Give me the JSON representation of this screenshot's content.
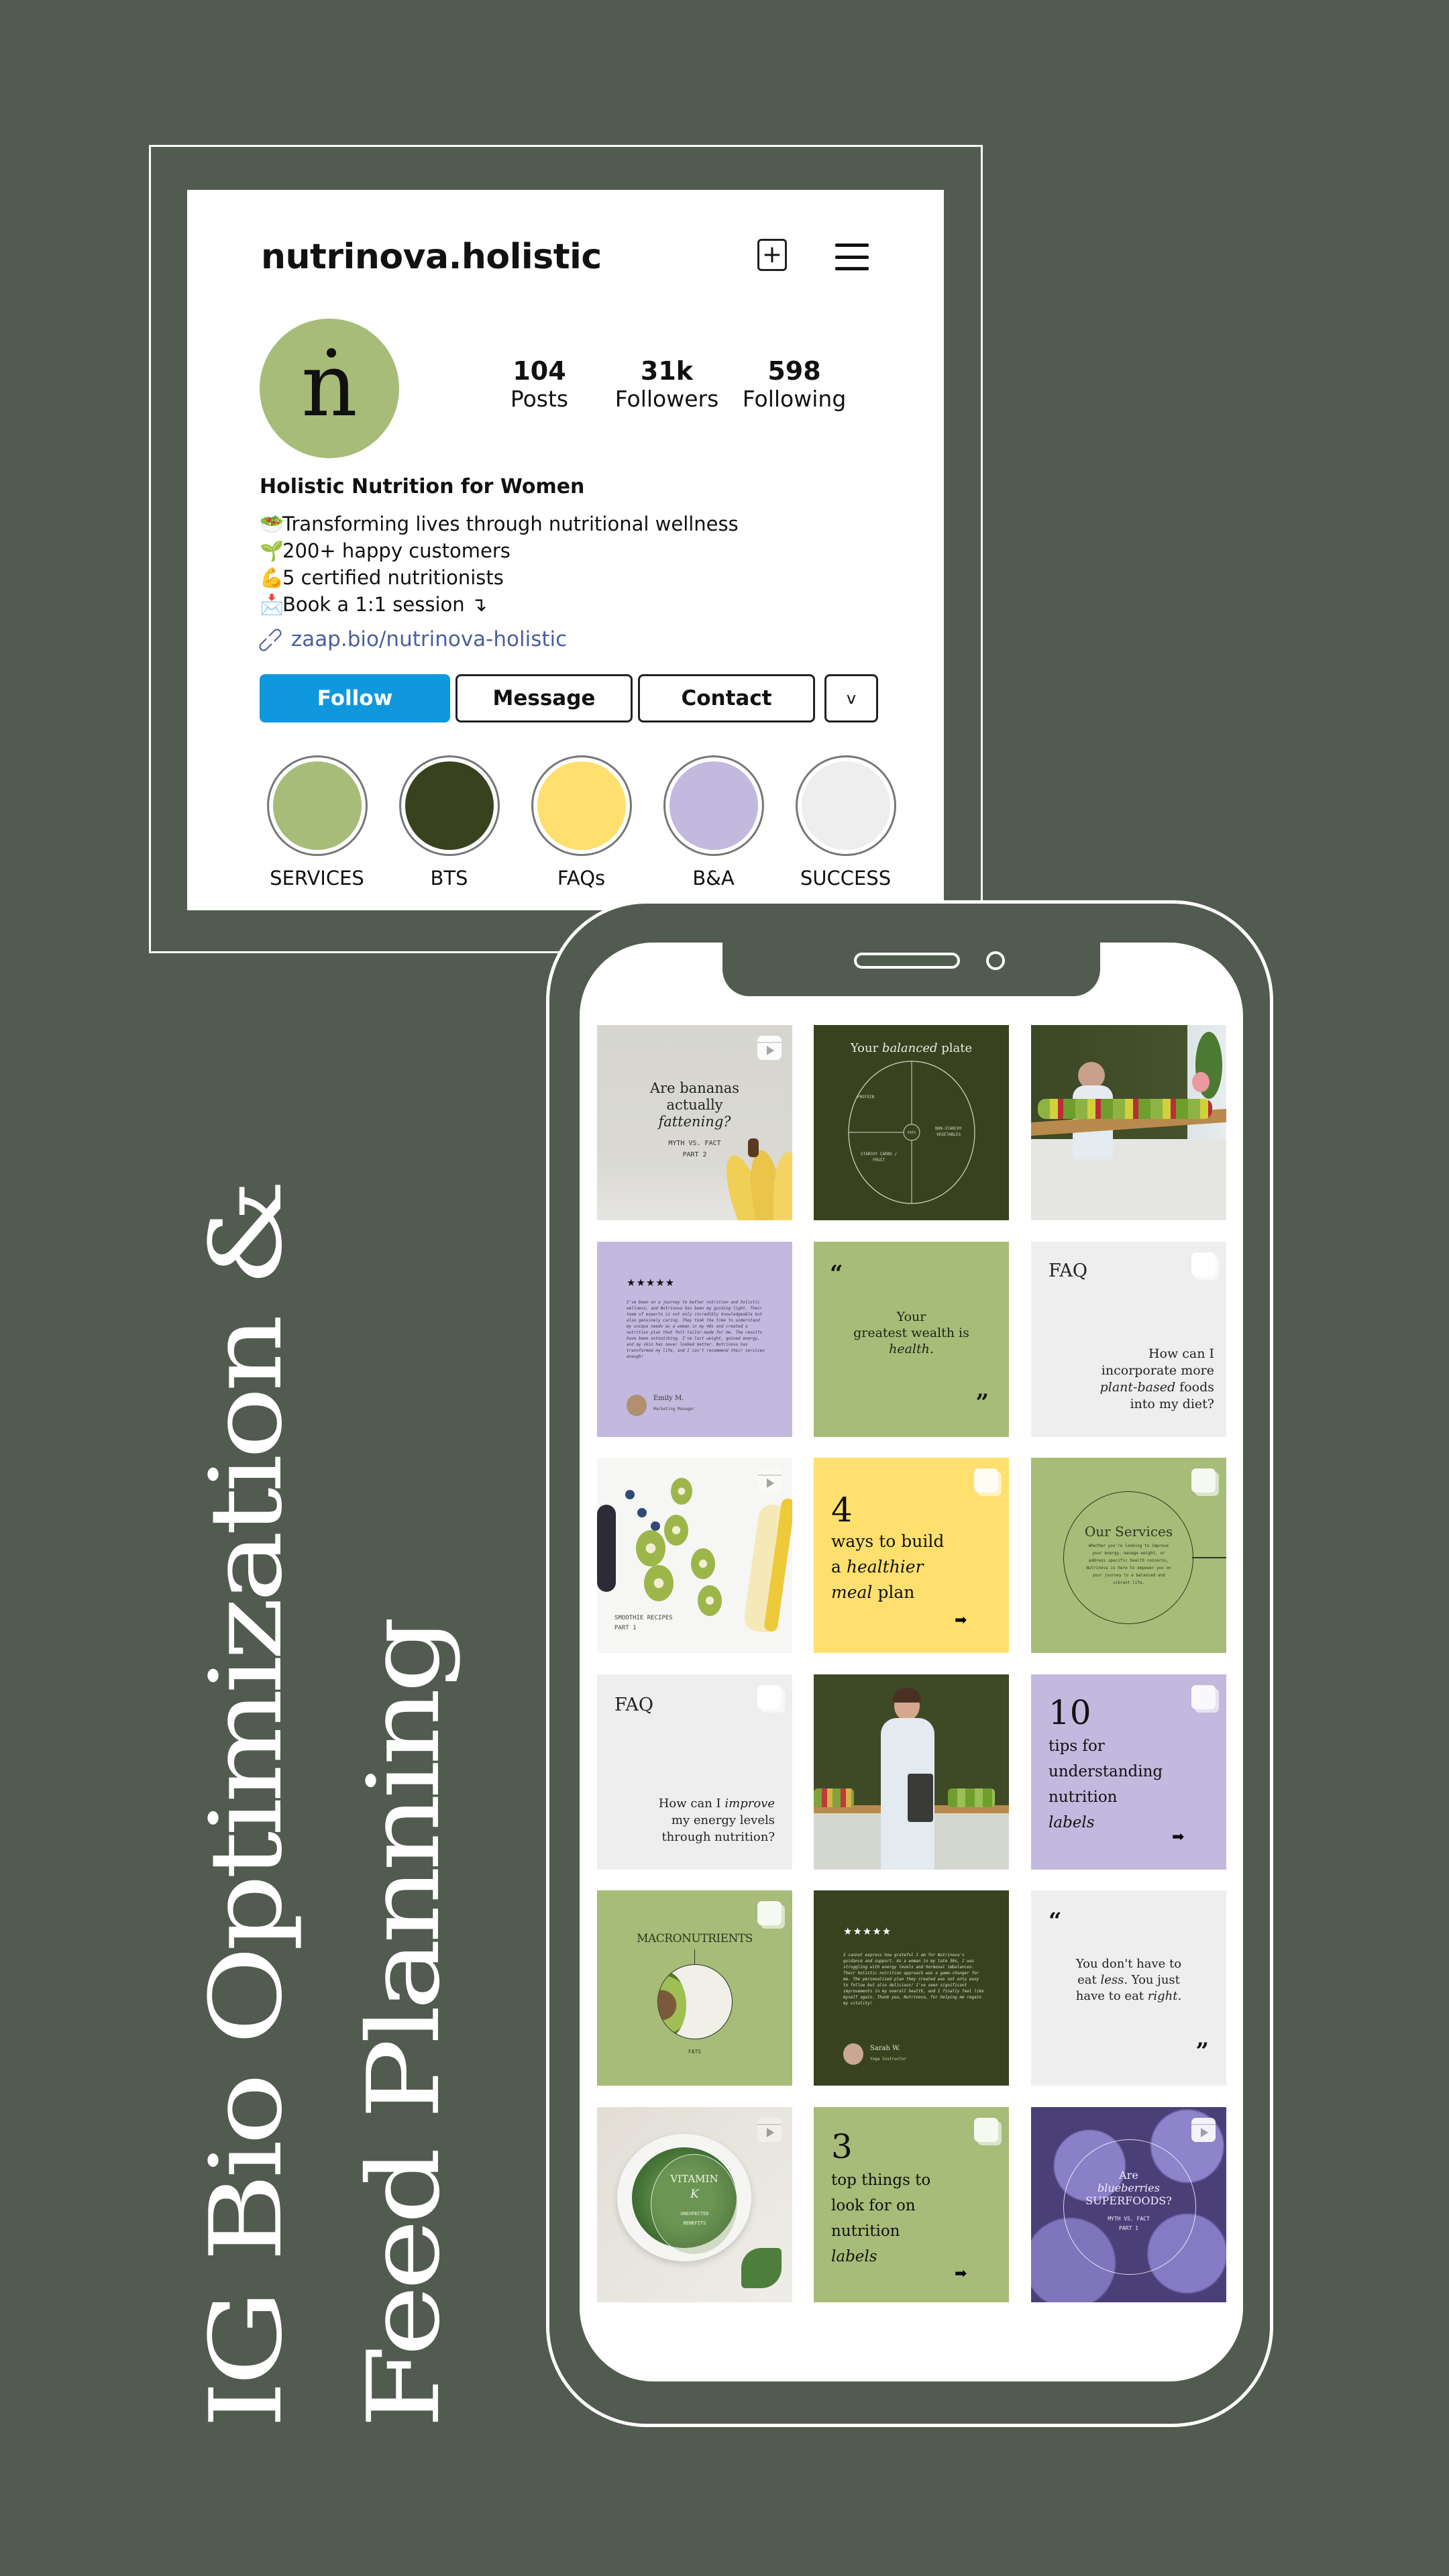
{
  "colors": {
    "background": "#515B4F",
    "follow_blue": "#1098DE",
    "sage_green": "#A6BC78",
    "dark_olive": "#38421F",
    "yellow": "#FFE06F",
    "lavender": "#C3B9DE",
    "light_gray": "#EEEEEE",
    "link_blue": "#4B5F9A"
  },
  "title": {
    "line1": "IG Bio Optimization &",
    "line2": "Feed Planning"
  },
  "profile": {
    "username": "nutrinova.holistic",
    "add_icon": "plus-square-icon",
    "menu_icon": "hamburger-menu-icon",
    "avatar_letter": "n",
    "stats": [
      {
        "value": "104",
        "label": "Posts"
      },
      {
        "value": "31k",
        "label": "Followers"
      },
      {
        "value": "598",
        "label": "Following"
      }
    ],
    "bio_name": "Holistic Nutrition for Women",
    "bio_lines": [
      {
        "emoji": "🥗",
        "text": "Transforming lives through nutritional wellness"
      },
      {
        "emoji": "🌱",
        "text": "200+ happy customers"
      },
      {
        "emoji": "💪",
        "text": "5 certified nutritionists"
      },
      {
        "emoji": "📩",
        "text": "Book a 1:1 session ↴"
      }
    ],
    "link_icon": "link-icon",
    "link": "zaap.bio/nutrinova-holistic",
    "buttons": {
      "follow": "Follow",
      "message": "Message",
      "contact": "Contact",
      "more": "v"
    },
    "highlights": [
      {
        "label": "SERVICES",
        "color": "#A6BC78"
      },
      {
        "label": "BTS",
        "color": "#38421F"
      },
      {
        "label": "FAQs",
        "color": "#FFE06F"
      },
      {
        "label": "B&A",
        "color": "#C3B9DE"
      },
      {
        "label": "SUCCESS",
        "color": "#EEEEEE"
      }
    ]
  },
  "feed": {
    "posts": [
      {
        "type": "reel",
        "bg": "#D9D8D3",
        "lines": [
          "Are bananas",
          "actually",
          "fattening?"
        ],
        "sub": [
          "MYTH VS. FACT",
          "PART 2"
        ]
      },
      {
        "type": "image",
        "bg": "#38421F",
        "title_pre": "Your",
        "title_em": "balanced",
        "title_post": "plate",
        "plate_labels": [
          "PROTEIN",
          "FATS",
          "NON-STARCHY VEGETABLES",
          "STARCHY CARBS / FRUIT"
        ]
      },
      {
        "type": "photo",
        "bg": "#3E4A26",
        "alt": "Nutritionist at table with vegetables"
      },
      {
        "type": "image",
        "bg": "#C3B9DE",
        "stars": "★★★★★",
        "review": "I've been on a journey to better nutrition and holistic wellness, and Nutrinova has been my guiding light. Their team of experts is not only incredibly knowledgeable but also genuinely caring. They took the time to understand my unique needs as a woman in my 40s and created a nutrition plan that felt tailor-made for me. The results have been astonishing. I've lost weight, gained energy, and my skin has never looked better. Nutrinova has transformed my life, and I can't recommend their services enough!",
        "name": "Emily M.",
        "role": "Marketing Manager"
      },
      {
        "type": "image",
        "bg": "#A6BC78",
        "quote_open": "“",
        "quote_close": "”",
        "lines": [
          "Your",
          "greatest wealth is"
        ],
        "em": "health."
      },
      {
        "type": "carousel",
        "bg": "#EEEEEE",
        "label": "FAQ",
        "lines": [
          "How can I",
          "incorporate more"
        ],
        "em": "plant-based",
        "after": "foods",
        "last": "into my diet?"
      },
      {
        "type": "reel",
        "bg": "#F6F6F4",
        "caption": [
          "SMOOTHIE RECIPES",
          "PART 1"
        ]
      },
      {
        "type": "carousel",
        "bg": "#FFE06F",
        "number": "4",
        "lines": [
          "ways to build"
        ],
        "em1": "healthier",
        "pre1": "a",
        "em2": "meal",
        "post2": "plan"
      },
      {
        "type": "carousel",
        "bg": "#A6BC78",
        "heading": "Our Services",
        "body": "Whether you're looking to improve your energy, manage weight, or address specific health concerns, Nutrinova is here to empower you on your journey to a balanced and vibrant life."
      },
      {
        "type": "carousel",
        "bg": "#EEEEEE",
        "label": "FAQ",
        "pre": "How can I",
        "em": "improve",
        "lines": [
          "my energy levels",
          "through nutrition?"
        ]
      },
      {
        "type": "photo",
        "bg": "#3E4A26",
        "alt": "Nutritionist holding tape measure and folder"
      },
      {
        "type": "carousel",
        "bg": "#C3B9DE",
        "number": "10",
        "lines": [
          "tips for",
          "understanding",
          "nutrition"
        ],
        "em": "labels"
      },
      {
        "type": "carousel",
        "bg": "#A6BC78",
        "heading": "MACRONUTRIENTS",
        "caption": "FATS"
      },
      {
        "type": "image",
        "bg": "#38421F",
        "stars": "★★★★★",
        "review": "I cannot express how grateful I am for Nutrinova's guidance and support. As a woman in my late 30s, I was struggling with energy levels and hormonal imbalances. Their holistic nutrition approach was a game-changer for me. The personalized plan they created was not only easy to follow but also delicious! I've seen significant improvements in my overall health, and I finally feel like myself again. Thank you, Nutrinova, for helping me regain my vitality!",
        "name": "Sarah W.",
        "role": "Yoga Instructor"
      },
      {
        "type": "image",
        "bg": "#EEEEEE",
        "quote_open": "“",
        "quote_close": "”",
        "l1": "You don't have to",
        "l2_pre": "eat",
        "l2_em": "less.",
        "l2_post": "You just",
        "l3_pre": "have to eat",
        "l3_em": "right."
      },
      {
        "type": "reel",
        "bg": "#E9E7E2",
        "heading": "VITAMIN",
        "em": "K",
        "sub": [
          "UNEXPECTED",
          "BENEFITS"
        ]
      },
      {
        "type": "carousel",
        "bg": "#A6BC78",
        "number": "3",
        "lines": [
          "top things to",
          "look for on",
          "nutrition"
        ],
        "em": "labels"
      },
      {
        "type": "reel",
        "bg": "#5B4F8E",
        "pre": "Are",
        "em": "blueberries",
        "heading": "SUPERFOODS?",
        "sub": [
          "MYTH VS. FACT",
          "PART 1"
        ]
      }
    ]
  }
}
